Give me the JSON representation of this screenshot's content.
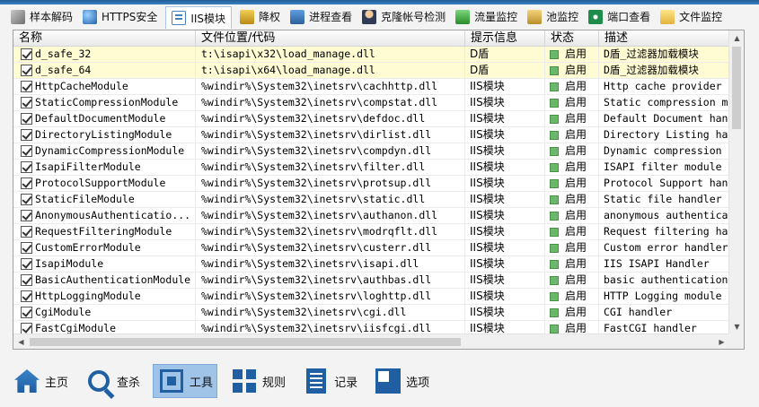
{
  "tabs": [
    {
      "label": "样本解码",
      "icon": "wrench-icon"
    },
    {
      "label": "HTTPS安全",
      "icon": "globe-icon"
    },
    {
      "label": "IIS模块",
      "icon": "iis-module-icon",
      "active": true
    },
    {
      "label": "降权",
      "icon": "lock-icon"
    },
    {
      "label": "进程查看",
      "icon": "process-icon"
    },
    {
      "label": "克隆帐号检测",
      "icon": "user-icon"
    },
    {
      "label": "流量监控",
      "icon": "chart-icon"
    },
    {
      "label": "池监控",
      "icon": "pool-icon"
    },
    {
      "label": "端口查看",
      "icon": "port-icon"
    },
    {
      "label": "文件监控",
      "icon": "folder-icon"
    }
  ],
  "table": {
    "columns": [
      "名称",
      "文件位置/代码",
      "提示信息",
      "状态",
      "描述"
    ],
    "rows": [
      {
        "name": "d_safe_32",
        "path": "t:\\isapi\\x32\\load_manage.dll",
        "hint": "D盾",
        "status": "启用",
        "desc": "D盾_过滤器加载模块",
        "highlight": true
      },
      {
        "name": "d_safe_64",
        "path": "t:\\isapi\\x64\\load_manage.dll",
        "hint": "D盾",
        "status": "启用",
        "desc": "D盾_过滤器加载模块",
        "highlight": true
      },
      {
        "name": "HttpCacheModule",
        "path": "%windir%\\System32\\inetsrv\\cachhttp.dll",
        "hint": "IIS模块",
        "status": "启用",
        "desc": "Http cache provider"
      },
      {
        "name": "StaticCompressionModule",
        "path": "%windir%\\System32\\inetsrv\\compstat.dll",
        "hint": "IIS模块",
        "status": "启用",
        "desc": "Static compression m"
      },
      {
        "name": "DefaultDocumentModule",
        "path": "%windir%\\System32\\inetsrv\\defdoc.dll",
        "hint": "IIS模块",
        "status": "启用",
        "desc": "Default Document han"
      },
      {
        "name": "DirectoryListingModule",
        "path": "%windir%\\System32\\inetsrv\\dirlist.dll",
        "hint": "IIS模块",
        "status": "启用",
        "desc": "Directory Listing ha"
      },
      {
        "name": "DynamicCompressionModule",
        "path": "%windir%\\System32\\inetsrv\\compdyn.dll",
        "hint": "IIS模块",
        "status": "启用",
        "desc": "Dynamic compression"
      },
      {
        "name": "IsapiFilterModule",
        "path": "%windir%\\System32\\inetsrv\\filter.dll",
        "hint": "IIS模块",
        "status": "启用",
        "desc": "ISAPI filter module"
      },
      {
        "name": "ProtocolSupportModule",
        "path": "%windir%\\System32\\inetsrv\\protsup.dll",
        "hint": "IIS模块",
        "status": "启用",
        "desc": "Protocol Support han"
      },
      {
        "name": "StaticFileModule",
        "path": "%windir%\\System32\\inetsrv\\static.dll",
        "hint": "IIS模块",
        "status": "启用",
        "desc": "Static file handler"
      },
      {
        "name": "AnonymousAuthenticatio...",
        "path": "%windir%\\System32\\inetsrv\\authanon.dll",
        "hint": "IIS模块",
        "status": "启用",
        "desc": "anonymous authentica"
      },
      {
        "name": "RequestFilteringModule",
        "path": "%windir%\\System32\\inetsrv\\modrqflt.dll",
        "hint": "IIS模块",
        "status": "启用",
        "desc": "Request filtering ha"
      },
      {
        "name": "CustomErrorModule",
        "path": "%windir%\\System32\\inetsrv\\custerr.dll",
        "hint": "IIS模块",
        "status": "启用",
        "desc": "Custom error handler"
      },
      {
        "name": "IsapiModule",
        "path": "%windir%\\System32\\inetsrv\\isapi.dll",
        "hint": "IIS模块",
        "status": "启用",
        "desc": "IIS ISAPI Handler"
      },
      {
        "name": "BasicAuthenticationModule",
        "path": "%windir%\\System32\\inetsrv\\authbas.dll",
        "hint": "IIS模块",
        "status": "启用",
        "desc": "basic authentication"
      },
      {
        "name": "HttpLoggingModule",
        "path": "%windir%\\System32\\inetsrv\\loghttp.dll",
        "hint": "IIS模块",
        "status": "启用",
        "desc": "HTTP Logging module"
      },
      {
        "name": "CgiModule",
        "path": "%windir%\\System32\\inetsrv\\cgi.dll",
        "hint": "IIS模块",
        "status": "启用",
        "desc": "CGI handler"
      },
      {
        "name": "FastCgiModule",
        "path": "%windir%\\System32\\inetsrv\\iisfcgi.dll",
        "hint": "IIS模块",
        "status": "启用",
        "desc": "FastCGI handler"
      }
    ]
  },
  "toolbar": [
    {
      "label": "主页",
      "icon": "home-icon"
    },
    {
      "label": "查杀",
      "icon": "search-icon"
    },
    {
      "label": "工具",
      "icon": "tools-icon",
      "active": true
    },
    {
      "label": "规则",
      "icon": "rules-icon"
    },
    {
      "label": "记录",
      "icon": "log-icon"
    },
    {
      "label": "选项",
      "icon": "options-icon"
    }
  ],
  "colors": {
    "highlight_row": "#fffbd2",
    "status_led": "#6ab96a",
    "accent": "#1f5fa2",
    "active_toolbar": "#9fc4e8"
  }
}
